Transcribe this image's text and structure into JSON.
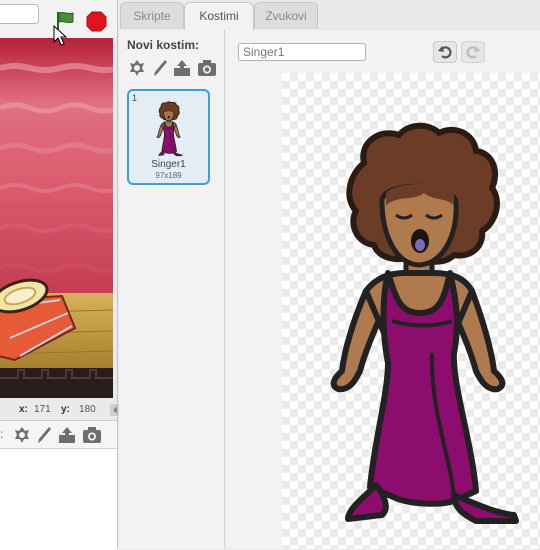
{
  "tabs": [
    {
      "label": "Skripte",
      "active": false
    },
    {
      "label": "Kostimi",
      "active": true
    },
    {
      "label": "Zvukovi",
      "active": false
    }
  ],
  "stage": {
    "coords": {
      "x_label": "x:",
      "x_value": "171",
      "y_label": "y:",
      "y_value": "180"
    }
  },
  "costume_list": {
    "new_costume_label": "Novi kostim:",
    "tool_icons": [
      "sprite-library-icon",
      "paint-brush-icon",
      "upload-icon",
      "camera-icon"
    ],
    "items": [
      {
        "index": "1",
        "name": "Singer1",
        "size": "97x189"
      }
    ]
  },
  "editor": {
    "costume_name_placeholder": "Singer1",
    "undo_icon": "undo-icon",
    "redo_icon": "redo-icon"
  },
  "colors": {
    "accent": "#3b9fe0",
    "flag_green": "#4a8c3a",
    "stop_red": "#e0141e",
    "dress": "#8c0d6e",
    "skin": "#b07a4f",
    "hair": "#6b3c26"
  }
}
